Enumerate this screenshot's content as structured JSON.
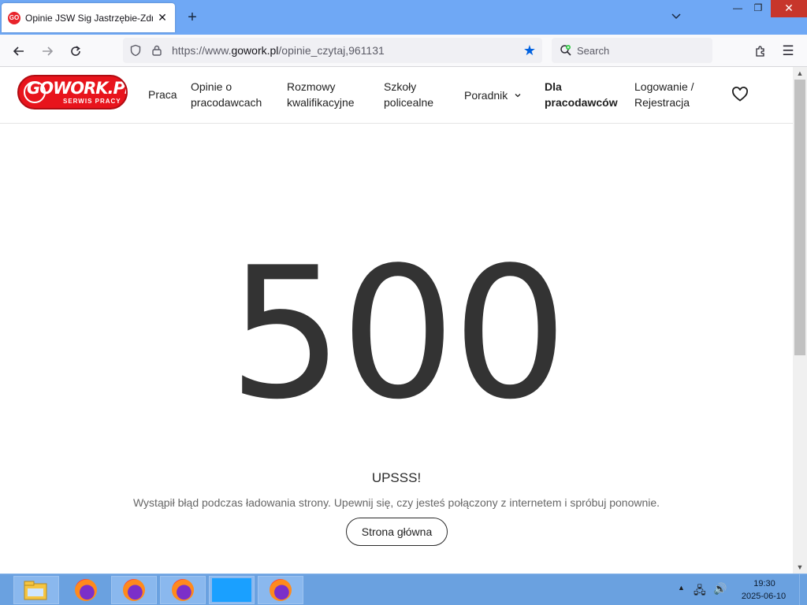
{
  "browser": {
    "tab_title": "Opinie JSW Sig Jastrzębie-Zdrój",
    "tab_favicon_text": "GO",
    "new_tab": "+",
    "url_prefix": "https://www.",
    "url_domain": "gowork.pl",
    "url_path": "/opinie_czytaj,961131",
    "search_placeholder": "Search"
  },
  "site": {
    "logo_main": "GOWORK.PL",
    "logo_sub": "SERWIS PRACY",
    "nav": {
      "praca": "Praca",
      "opinie_1": "Opinie o",
      "opinie_2": "pracodawcach",
      "rozmowy_1": "Rozmowy",
      "rozmowy_2": "kwalifikacyjne",
      "szkoly_1": "Szkoły",
      "szkoly_2": "policealne",
      "poradnik": "Poradnik",
      "dla_1": "Dla",
      "dla_2": "pracodawców",
      "login_1": "Logowanie /",
      "login_2": "Rejestracja"
    }
  },
  "error": {
    "code": "500",
    "title": "UPSSS!",
    "message": "Wystąpił błąd podczas ładowania strony. Upewnij się, czy jesteś połączony z internetem i spróbuj ponownie.",
    "home_button": "Strona główna"
  },
  "taskbar": {
    "time": "19:30",
    "date": "2025-06-10"
  },
  "colors": {
    "brand_red": "#e8141c",
    "taskbar_blue": "#6aa1e0",
    "tabstrip_blue": "#6fa8f5",
    "bookmark_star": "#0061e0"
  }
}
